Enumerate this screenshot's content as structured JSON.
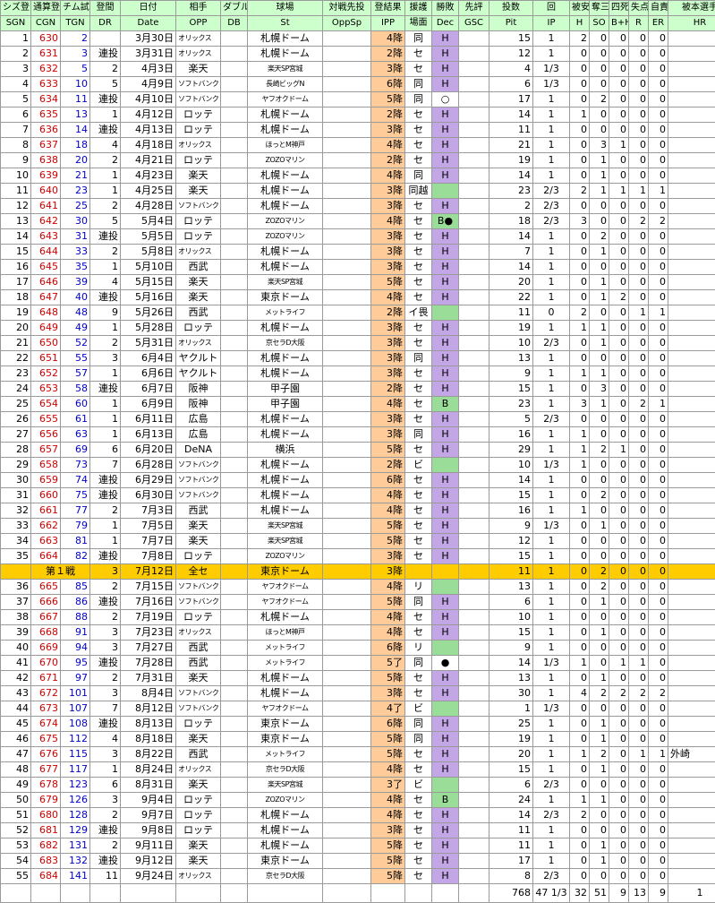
{
  "headers": {
    "row1": [
      "シズ登",
      "通算登",
      "チム試",
      "登間",
      "日付",
      "相手",
      "ダブル",
      "球場",
      "対戦先投",
      "登結果",
      "援護",
      "勝敗",
      "先評",
      "投数",
      "回",
      "被安",
      "奪三",
      "四死",
      "失点",
      "自責",
      "被本選手"
    ],
    "row2": [
      "SGN",
      "CGN",
      "TGN",
      "DR",
      "Date",
      "OPP",
      "DB",
      "St",
      "OppSp",
      "IPP",
      "場面",
      "Dec",
      "GSC",
      "Pit",
      "IP",
      "H",
      "SO",
      "B+H",
      "R",
      "ER",
      "HR"
    ]
  },
  "rows": [
    {
      "sgn": "1",
      "cgn": "630",
      "tgn": "2",
      "dr": "",
      "date": "3月30日",
      "opp": "オリックス",
      "st": "札幌ドーム",
      "ipp": "4降",
      "scene": "同",
      "dec": "H",
      "pit": "15",
      "ip": "1",
      "h": "2",
      "so": "0",
      "bh": "0",
      "r": "0",
      "er": "0",
      "hr": ""
    },
    {
      "sgn": "2",
      "cgn": "631",
      "tgn": "3",
      "dr": "連投",
      "date": "3月31日",
      "opp": "オリックス",
      "st": "札幌ドーム",
      "ipp": "2降",
      "scene": "セ",
      "dec": "H",
      "pit": "12",
      "ip": "1",
      "h": "0",
      "so": "0",
      "bh": "0",
      "r": "0",
      "er": "0",
      "hr": ""
    },
    {
      "sgn": "3",
      "cgn": "632",
      "tgn": "5",
      "dr": "2",
      "date": "4月3日",
      "opp": "楽天",
      "st": "楽天SP宮城",
      "ipp": "3降",
      "scene": "セ",
      "dec": "H",
      "pit": "4",
      "ip": "1/3",
      "h": "0",
      "so": "0",
      "bh": "0",
      "r": "0",
      "er": "0",
      "hr": ""
    },
    {
      "sgn": "4",
      "cgn": "633",
      "tgn": "10",
      "dr": "5",
      "date": "4月9日",
      "opp": "ソフトバンク",
      "st": "長崎ビッグN",
      "ipp": "6降",
      "scene": "同",
      "dec": "H",
      "pit": "6",
      "ip": "1/3",
      "h": "0",
      "so": "0",
      "bh": "0",
      "r": "0",
      "er": "0",
      "hr": ""
    },
    {
      "sgn": "5",
      "cgn": "634",
      "tgn": "11",
      "dr": "連投",
      "date": "4月10日",
      "opp": "ソフトバンク",
      "st": "ヤフオクドーム",
      "ipp": "5降",
      "scene": "同",
      "dec": "○",
      "pit": "17",
      "ip": "1",
      "h": "0",
      "so": "2",
      "bh": "0",
      "r": "0",
      "er": "0",
      "hr": ""
    },
    {
      "sgn": "6",
      "cgn": "635",
      "tgn": "13",
      "dr": "1",
      "date": "4月12日",
      "opp": "ロッテ",
      "st": "札幌ドーム",
      "ipp": "2降",
      "scene": "セ",
      "dec": "H",
      "pit": "14",
      "ip": "1",
      "h": "1",
      "so": "0",
      "bh": "0",
      "r": "0",
      "er": "0",
      "hr": ""
    },
    {
      "sgn": "7",
      "cgn": "636",
      "tgn": "14",
      "dr": "連投",
      "date": "4月13日",
      "opp": "ロッテ",
      "st": "札幌ドーム",
      "ipp": "3降",
      "scene": "セ",
      "dec": "H",
      "pit": "11",
      "ip": "1",
      "h": "0",
      "so": "0",
      "bh": "0",
      "r": "0",
      "er": "0",
      "hr": ""
    },
    {
      "sgn": "8",
      "cgn": "637",
      "tgn": "18",
      "dr": "4",
      "date": "4月18日",
      "opp": "オリックス",
      "st": "ほっとM神戸",
      "ipp": "4降",
      "scene": "セ",
      "dec": "H",
      "pit": "21",
      "ip": "1",
      "h": "0",
      "so": "3",
      "bh": "1",
      "r": "0",
      "er": "0",
      "hr": ""
    },
    {
      "sgn": "9",
      "cgn": "638",
      "tgn": "20",
      "dr": "2",
      "date": "4月21日",
      "opp": "ロッテ",
      "st": "ZOZOマリン",
      "ipp": "2降",
      "scene": "セ",
      "dec": "H",
      "pit": "19",
      "ip": "1",
      "h": "0",
      "so": "1",
      "bh": "0",
      "r": "0",
      "er": "0",
      "hr": ""
    },
    {
      "sgn": "10",
      "cgn": "639",
      "tgn": "21",
      "dr": "1",
      "date": "4月23日",
      "opp": "楽天",
      "st": "札幌ドーム",
      "ipp": "4降",
      "scene": "同",
      "dec": "H",
      "pit": "14",
      "ip": "1",
      "h": "0",
      "so": "1",
      "bh": "0",
      "r": "0",
      "er": "0",
      "hr": ""
    },
    {
      "sgn": "11",
      "cgn": "640",
      "tgn": "23",
      "dr": "1",
      "date": "4月25日",
      "opp": "楽天",
      "st": "札幌ドーム",
      "ipp": "3降",
      "scene": "同越",
      "dec": "",
      "pit": "23",
      "ip": "2/3",
      "h": "2",
      "so": "1",
      "bh": "1",
      "r": "1",
      "er": "1",
      "hr": ""
    },
    {
      "sgn": "12",
      "cgn": "641",
      "tgn": "25",
      "dr": "2",
      "date": "4月28日",
      "opp": "ソフトバンク",
      "st": "札幌ドーム",
      "ipp": "3降",
      "scene": "セ",
      "dec": "H",
      "pit": "2",
      "ip": "2/3",
      "h": "0",
      "so": "0",
      "bh": "0",
      "r": "0",
      "er": "0",
      "hr": ""
    },
    {
      "sgn": "13",
      "cgn": "642",
      "tgn": "30",
      "dr": "5",
      "date": "5月4日",
      "opp": "ロッテ",
      "st": "ZOZOマリン",
      "ipp": "4降",
      "scene": "セ",
      "dec": "B●",
      "pit": "18",
      "ip": "2/3",
      "h": "3",
      "so": "0",
      "bh": "0",
      "r": "2",
      "er": "2",
      "hr": ""
    },
    {
      "sgn": "14",
      "cgn": "643",
      "tgn": "31",
      "dr": "連投",
      "date": "5月5日",
      "opp": "ロッテ",
      "st": "ZOZOマリン",
      "ipp": "3降",
      "scene": "セ",
      "dec": "H",
      "pit": "14",
      "ip": "1",
      "h": "0",
      "so": "2",
      "bh": "0",
      "r": "0",
      "er": "0",
      "hr": ""
    },
    {
      "sgn": "15",
      "cgn": "644",
      "tgn": "33",
      "dr": "2",
      "date": "5月8日",
      "opp": "オリックス",
      "st": "札幌ドーム",
      "ipp": "3降",
      "scene": "セ",
      "dec": "H",
      "pit": "7",
      "ip": "1",
      "h": "0",
      "so": "1",
      "bh": "0",
      "r": "0",
      "er": "0",
      "hr": ""
    },
    {
      "sgn": "16",
      "cgn": "645",
      "tgn": "35",
      "dr": "1",
      "date": "5月10日",
      "opp": "西武",
      "st": "札幌ドーム",
      "ipp": "3降",
      "scene": "セ",
      "dec": "H",
      "pit": "14",
      "ip": "1",
      "h": "0",
      "so": "0",
      "bh": "0",
      "r": "0",
      "er": "0",
      "hr": ""
    },
    {
      "sgn": "17",
      "cgn": "646",
      "tgn": "39",
      "dr": "4",
      "date": "5月15日",
      "opp": "楽天",
      "st": "楽天SP宮城",
      "ipp": "5降",
      "scene": "セ",
      "dec": "H",
      "pit": "20",
      "ip": "1",
      "h": "0",
      "so": "1",
      "bh": "0",
      "r": "0",
      "er": "0",
      "hr": ""
    },
    {
      "sgn": "18",
      "cgn": "647",
      "tgn": "40",
      "dr": "連投",
      "date": "5月16日",
      "opp": "楽天",
      "st": "東京ドーム",
      "ipp": "4降",
      "scene": "セ",
      "dec": "H",
      "pit": "22",
      "ip": "1",
      "h": "0",
      "so": "1",
      "bh": "2",
      "r": "0",
      "er": "0",
      "hr": ""
    },
    {
      "sgn": "19",
      "cgn": "648",
      "tgn": "48",
      "dr": "9",
      "date": "5月26日",
      "opp": "西武",
      "st": "メットライフ",
      "ipp": "2降",
      "scene": "イ畏",
      "dec": "",
      "pit": "11",
      "ip": "0",
      "h": "2",
      "so": "0",
      "bh": "0",
      "r": "1",
      "er": "1",
      "hr": ""
    },
    {
      "sgn": "20",
      "cgn": "649",
      "tgn": "49",
      "dr": "1",
      "date": "5月28日",
      "opp": "ロッテ",
      "st": "札幌ドーム",
      "ipp": "3降",
      "scene": "セ",
      "dec": "H",
      "pit": "19",
      "ip": "1",
      "h": "1",
      "so": "1",
      "bh": "0",
      "r": "0",
      "er": "0",
      "hr": ""
    },
    {
      "sgn": "21",
      "cgn": "650",
      "tgn": "52",
      "dr": "2",
      "date": "5月31日",
      "opp": "オリックス",
      "st": "京セラD大阪",
      "ipp": "3降",
      "scene": "セ",
      "dec": "H",
      "pit": "10",
      "ip": "2/3",
      "h": "0",
      "so": "1",
      "bh": "0",
      "r": "0",
      "er": "0",
      "hr": ""
    },
    {
      "sgn": "22",
      "cgn": "651",
      "tgn": "55",
      "dr": "3",
      "date": "6月4日",
      "opp": "ヤクルト",
      "st": "札幌ドーム",
      "ipp": "3降",
      "scene": "同",
      "dec": "H",
      "pit": "13",
      "ip": "1",
      "h": "0",
      "so": "0",
      "bh": "0",
      "r": "0",
      "er": "0",
      "hr": ""
    },
    {
      "sgn": "23",
      "cgn": "652",
      "tgn": "57",
      "dr": "1",
      "date": "6月6日",
      "opp": "ヤクルト",
      "st": "札幌ドーム",
      "ipp": "3降",
      "scene": "セ",
      "dec": "H",
      "pit": "9",
      "ip": "1",
      "h": "1",
      "so": "1",
      "bh": "0",
      "r": "0",
      "er": "0",
      "hr": ""
    },
    {
      "sgn": "24",
      "cgn": "653",
      "tgn": "58",
      "dr": "連投",
      "date": "6月7日",
      "opp": "阪神",
      "st": "甲子園",
      "ipp": "2降",
      "scene": "セ",
      "dec": "H",
      "pit": "15",
      "ip": "1",
      "h": "0",
      "so": "3",
      "bh": "0",
      "r": "0",
      "er": "0",
      "hr": ""
    },
    {
      "sgn": "25",
      "cgn": "654",
      "tgn": "60",
      "dr": "1",
      "date": "6月9日",
      "opp": "阪神",
      "st": "甲子園",
      "ipp": "4降",
      "scene": "セ",
      "dec": "B",
      "pit": "23",
      "ip": "1",
      "h": "3",
      "so": "1",
      "bh": "0",
      "r": "2",
      "er": "1",
      "hr": ""
    },
    {
      "sgn": "26",
      "cgn": "655",
      "tgn": "61",
      "dr": "1",
      "date": "6月11日",
      "opp": "広島",
      "st": "札幌ドーム",
      "ipp": "3降",
      "scene": "セ",
      "dec": "H",
      "pit": "5",
      "ip": "2/3",
      "h": "0",
      "so": "0",
      "bh": "0",
      "r": "0",
      "er": "0",
      "hr": ""
    },
    {
      "sgn": "27",
      "cgn": "656",
      "tgn": "63",
      "dr": "1",
      "date": "6月13日",
      "opp": "広島",
      "st": "札幌ドーム",
      "ipp": "3降",
      "scene": "同",
      "dec": "H",
      "pit": "16",
      "ip": "1",
      "h": "1",
      "so": "0",
      "bh": "0",
      "r": "0",
      "er": "0",
      "hr": ""
    },
    {
      "sgn": "28",
      "cgn": "657",
      "tgn": "69",
      "dr": "6",
      "date": "6月20日",
      "opp": "DeNA",
      "st": "横浜",
      "ipp": "5降",
      "scene": "セ",
      "dec": "H",
      "pit": "29",
      "ip": "1",
      "h": "1",
      "so": "2",
      "bh": "1",
      "r": "0",
      "er": "0",
      "hr": ""
    },
    {
      "sgn": "29",
      "cgn": "658",
      "tgn": "73",
      "dr": "7",
      "date": "6月28日",
      "opp": "ソフトバンク",
      "st": "札幌ドーム",
      "ipp": "2降",
      "scene": "ビ",
      "dec": "",
      "pit": "10",
      "ip": "1/3",
      "h": "1",
      "so": "0",
      "bh": "0",
      "r": "0",
      "er": "0",
      "hr": ""
    },
    {
      "sgn": "30",
      "cgn": "659",
      "tgn": "74",
      "dr": "連投",
      "date": "6月29日",
      "opp": "ソフトバンク",
      "st": "札幌ドーム",
      "ipp": "6降",
      "scene": "セ",
      "dec": "H",
      "pit": "14",
      "ip": "1",
      "h": "0",
      "so": "0",
      "bh": "0",
      "r": "0",
      "er": "0",
      "hr": ""
    },
    {
      "sgn": "31",
      "cgn": "660",
      "tgn": "75",
      "dr": "連投",
      "date": "6月30日",
      "opp": "ソフトバンク",
      "st": "札幌ドーム",
      "ipp": "4降",
      "scene": "セ",
      "dec": "H",
      "pit": "15",
      "ip": "1",
      "h": "0",
      "so": "2",
      "bh": "0",
      "r": "0",
      "er": "0",
      "hr": ""
    },
    {
      "sgn": "32",
      "cgn": "661",
      "tgn": "77",
      "dr": "2",
      "date": "7月3日",
      "opp": "西武",
      "st": "札幌ドーム",
      "ipp": "4降",
      "scene": "セ",
      "dec": "H",
      "pit": "16",
      "ip": "1",
      "h": "1",
      "so": "0",
      "bh": "0",
      "r": "0",
      "er": "0",
      "hr": ""
    },
    {
      "sgn": "33",
      "cgn": "662",
      "tgn": "79",
      "dr": "1",
      "date": "7月5日",
      "opp": "楽天",
      "st": "楽天SP宮城",
      "ipp": "5降",
      "scene": "セ",
      "dec": "H",
      "pit": "9",
      "ip": "1/3",
      "h": "0",
      "so": "1",
      "bh": "0",
      "r": "0",
      "er": "0",
      "hr": ""
    },
    {
      "sgn": "34",
      "cgn": "663",
      "tgn": "81",
      "dr": "1",
      "date": "7月7日",
      "opp": "楽天",
      "st": "楽天SP宮城",
      "ipp": "5降",
      "scene": "セ",
      "dec": "H",
      "pit": "12",
      "ip": "1",
      "h": "0",
      "so": "0",
      "bh": "0",
      "r": "0",
      "er": "0",
      "hr": ""
    },
    {
      "sgn": "35",
      "cgn": "664",
      "tgn": "82",
      "dr": "連投",
      "date": "7月8日",
      "opp": "ロッテ",
      "st": "ZOZOマリン",
      "ipp": "3降",
      "scene": "セ",
      "dec": "H",
      "pit": "15",
      "ip": "1",
      "h": "0",
      "so": "0",
      "bh": "0",
      "r": "0",
      "er": "0",
      "hr": ""
    }
  ],
  "allstar": {
    "label": "第１戦",
    "dr": "3",
    "date": "7月12日",
    "opp": "全セ",
    "st": "東京ドーム",
    "ipp": "3降",
    "pit": "11",
    "ip": "1",
    "h": "0",
    "so": "2",
    "bh": "0",
    "r": "0",
    "er": "0"
  },
  "rows2": [
    {
      "sgn": "36",
      "cgn": "665",
      "tgn": "85",
      "dr": "2",
      "date": "7月15日",
      "opp": "ソフトバンク",
      "st": "ヤフオクドーム",
      "ipp": "4降",
      "scene": "リ",
      "dec": "",
      "pit": "13",
      "ip": "1",
      "h": "0",
      "so": "2",
      "bh": "0",
      "r": "0",
      "er": "0",
      "hr": ""
    },
    {
      "sgn": "37",
      "cgn": "666",
      "tgn": "86",
      "dr": "連投",
      "date": "7月16日",
      "opp": "ソフトバンク",
      "st": "ヤフオクドーム",
      "ipp": "5降",
      "scene": "同",
      "dec": "H",
      "pit": "6",
      "ip": "1",
      "h": "0",
      "so": "1",
      "bh": "0",
      "r": "0",
      "er": "0",
      "hr": ""
    },
    {
      "sgn": "38",
      "cgn": "667",
      "tgn": "88",
      "dr": "2",
      "date": "7月19日",
      "opp": "ロッテ",
      "st": "札幌ドーム",
      "ipp": "4降",
      "scene": "セ",
      "dec": "H",
      "pit": "10",
      "ip": "1",
      "h": "0",
      "so": "0",
      "bh": "0",
      "r": "0",
      "er": "0",
      "hr": ""
    },
    {
      "sgn": "39",
      "cgn": "668",
      "tgn": "91",
      "dr": "3",
      "date": "7月23日",
      "opp": "オリックス",
      "st": "ほっとM神戸",
      "ipp": "4降",
      "scene": "セ",
      "dec": "H",
      "pit": "15",
      "ip": "1",
      "h": "0",
      "so": "1",
      "bh": "0",
      "r": "0",
      "er": "0",
      "hr": ""
    },
    {
      "sgn": "40",
      "cgn": "669",
      "tgn": "94",
      "dr": "3",
      "date": "7月27日",
      "opp": "西武",
      "st": "メットライフ",
      "ipp": "6降",
      "scene": "リ",
      "dec": "",
      "pit": "9",
      "ip": "1",
      "h": "0",
      "so": "0",
      "bh": "0",
      "r": "0",
      "er": "0",
      "hr": ""
    },
    {
      "sgn": "41",
      "cgn": "670",
      "tgn": "95",
      "dr": "連投",
      "date": "7月28日",
      "opp": "西武",
      "st": "メットライフ",
      "ipp": "5了",
      "scene": "同",
      "dec": "●",
      "pit": "14",
      "ip": "1/3",
      "h": "1",
      "so": "0",
      "bh": "1",
      "r": "1",
      "er": "0",
      "hr": ""
    },
    {
      "sgn": "42",
      "cgn": "671",
      "tgn": "97",
      "dr": "2",
      "date": "7月31日",
      "opp": "楽天",
      "st": "札幌ドーム",
      "ipp": "5降",
      "scene": "セ",
      "dec": "H",
      "pit": "13",
      "ip": "1",
      "h": "0",
      "so": "1",
      "bh": "0",
      "r": "0",
      "er": "0",
      "hr": ""
    },
    {
      "sgn": "43",
      "cgn": "672",
      "tgn": "101",
      "dr": "3",
      "date": "8月4日",
      "opp": "ソフトバンク",
      "st": "札幌ドーム",
      "ipp": "3降",
      "scene": "セ",
      "dec": "H",
      "pit": "30",
      "ip": "1",
      "h": "4",
      "so": "2",
      "bh": "2",
      "r": "2",
      "er": "2",
      "hr": ""
    },
    {
      "sgn": "44",
      "cgn": "673",
      "tgn": "107",
      "dr": "7",
      "date": "8月12日",
      "opp": "ソフトバンク",
      "st": "ヤフオクドーム",
      "ipp": "4了",
      "scene": "ビ",
      "dec": "",
      "pit": "1",
      "ip": "1/3",
      "h": "0",
      "so": "0",
      "bh": "0",
      "r": "0",
      "er": "0",
      "hr": ""
    },
    {
      "sgn": "45",
      "cgn": "674",
      "tgn": "108",
      "dr": "連投",
      "date": "8月13日",
      "opp": "ロッテ",
      "st": "東京ドーム",
      "ipp": "6降",
      "scene": "同",
      "dec": "H",
      "pit": "25",
      "ip": "1",
      "h": "0",
      "so": "1",
      "bh": "0",
      "r": "0",
      "er": "0",
      "hr": ""
    },
    {
      "sgn": "46",
      "cgn": "675",
      "tgn": "112",
      "dr": "4",
      "date": "8月18日",
      "opp": "楽天",
      "st": "東京ドーム",
      "ipp": "5降",
      "scene": "同",
      "dec": "H",
      "pit": "19",
      "ip": "1",
      "h": "0",
      "so": "1",
      "bh": "0",
      "r": "0",
      "er": "0",
      "hr": ""
    },
    {
      "sgn": "47",
      "cgn": "676",
      "tgn": "115",
      "dr": "3",
      "date": "8月22日",
      "opp": "西武",
      "st": "メットライフ",
      "ipp": "5降",
      "scene": "セ",
      "dec": "H",
      "pit": "20",
      "ip": "1",
      "h": "1",
      "so": "2",
      "bh": "0",
      "r": "1",
      "er": "1",
      "hr": "外崎"
    },
    {
      "sgn": "48",
      "cgn": "677",
      "tgn": "117",
      "dr": "1",
      "date": "8月24日",
      "opp": "オリックス",
      "st": "京セラD大阪",
      "ipp": "4降",
      "scene": "セ",
      "dec": "H",
      "pit": "15",
      "ip": "1",
      "h": "0",
      "so": "1",
      "bh": "0",
      "r": "0",
      "er": "0",
      "hr": ""
    },
    {
      "sgn": "49",
      "cgn": "678",
      "tgn": "123",
      "dr": "6",
      "date": "8月31日",
      "opp": "楽天",
      "st": "楽天SP宮城",
      "ipp": "3了",
      "scene": "ビ",
      "dec": "",
      "pit": "6",
      "ip": "2/3",
      "h": "0",
      "so": "0",
      "bh": "0",
      "r": "0",
      "er": "0",
      "hr": ""
    },
    {
      "sgn": "50",
      "cgn": "679",
      "tgn": "126",
      "dr": "3",
      "date": "9月4日",
      "opp": "ロッテ",
      "st": "ZOZOマリン",
      "ipp": "4降",
      "scene": "セ",
      "dec": "B",
      "pit": "24",
      "ip": "1",
      "h": "1",
      "so": "1",
      "bh": "0",
      "r": "0",
      "er": "0",
      "hr": ""
    },
    {
      "sgn": "51",
      "cgn": "680",
      "tgn": "128",
      "dr": "2",
      "date": "9月7日",
      "opp": "ロッテ",
      "st": "札幌ドーム",
      "ipp": "4降",
      "scene": "セ",
      "dec": "H",
      "pit": "14",
      "ip": "2/3",
      "h": "2",
      "so": "0",
      "bh": "0",
      "r": "0",
      "er": "0",
      "hr": ""
    },
    {
      "sgn": "52",
      "cgn": "681",
      "tgn": "129",
      "dr": "連投",
      "date": "9月8日",
      "opp": "ロッテ",
      "st": "札幌ドーム",
      "ipp": "3降",
      "scene": "セ",
      "dec": "H",
      "pit": "11",
      "ip": "1",
      "h": "0",
      "so": "0",
      "bh": "0",
      "r": "0",
      "er": "0",
      "hr": ""
    },
    {
      "sgn": "53",
      "cgn": "682",
      "tgn": "131",
      "dr": "2",
      "date": "9月11日",
      "opp": "楽天",
      "st": "札幌ドーム",
      "ipp": "5降",
      "scene": "セ",
      "dec": "H",
      "pit": "11",
      "ip": "1",
      "h": "0",
      "so": "1",
      "bh": "0",
      "r": "0",
      "er": "0",
      "hr": ""
    },
    {
      "sgn": "54",
      "cgn": "683",
      "tgn": "132",
      "dr": "連投",
      "date": "9月12日",
      "opp": "楽天",
      "st": "東京ドーム",
      "ipp": "5降",
      "scene": "セ",
      "dec": "H",
      "pit": "17",
      "ip": "1",
      "h": "0",
      "so": "1",
      "bh": "0",
      "r": "0",
      "er": "0",
      "hr": ""
    },
    {
      "sgn": "55",
      "cgn": "684",
      "tgn": "141",
      "dr": "11",
      "date": "9月24日",
      "opp": "オリックス",
      "st": "京セラD大阪",
      "ipp": "5降",
      "scene": "セ",
      "dec": "H",
      "pit": "8",
      "ip": "2/3",
      "h": "0",
      "so": "0",
      "bh": "0",
      "r": "0",
      "er": "0",
      "hr": ""
    }
  ],
  "totals": {
    "pit": "768",
    "ip": "47 1/3",
    "h": "32",
    "so": "51",
    "bh": "9",
    "r": "13",
    "er": "9",
    "hr": "1"
  }
}
